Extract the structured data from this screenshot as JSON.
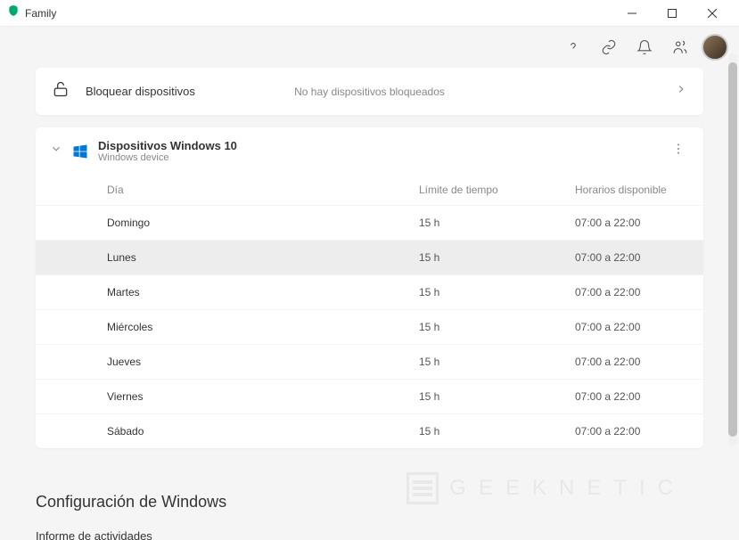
{
  "titlebar": {
    "app_name": "Family"
  },
  "lock_card": {
    "title": "Bloquear dispositivos",
    "status": "No hay dispositivos bloqueados"
  },
  "device": {
    "title": "Dispositivos Windows 10",
    "subtitle": "Windows device",
    "columns": {
      "day": "Día",
      "limit": "Límite de tiempo",
      "hours": "Horarios disponible"
    },
    "rows": [
      {
        "day": "Domingo",
        "limit": "15 h",
        "hours": "07:00 a 22:00",
        "highlighted": false
      },
      {
        "day": "Lunes",
        "limit": "15 h",
        "hours": "07:00 a 22:00",
        "highlighted": true
      },
      {
        "day": "Martes",
        "limit": "15 h",
        "hours": "07:00 a 22:00",
        "highlighted": false
      },
      {
        "day": "Miércoles",
        "limit": "15 h",
        "hours": "07:00 a 22:00",
        "highlighted": false
      },
      {
        "day": "Jueves",
        "limit": "15 h",
        "hours": "07:00 a 22:00",
        "highlighted": false
      },
      {
        "day": "Viernes",
        "limit": "15 h",
        "hours": "07:00 a 22:00",
        "highlighted": false
      },
      {
        "day": "Sábado",
        "limit": "15 h",
        "hours": "07:00 a 22:00",
        "highlighted": false
      }
    ]
  },
  "section": {
    "title": "Configuración de Windows",
    "link": "Informe de actividades"
  },
  "watermark": "GEEKNETIC"
}
